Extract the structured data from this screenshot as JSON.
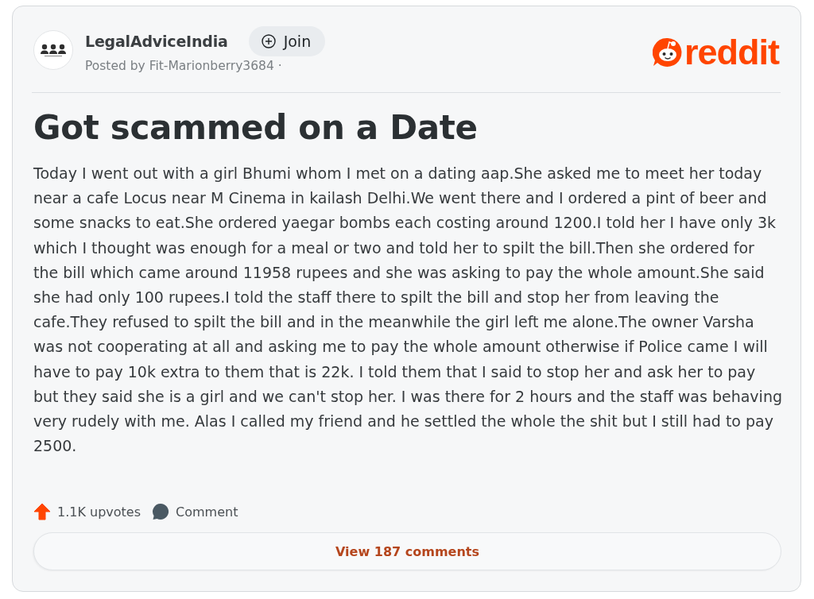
{
  "post": {
    "subreddit": "LegalAdviceIndia",
    "join_button": {
      "label": "Join"
    },
    "posted_by": "Posted by Fit-Marionberry3684 ·",
    "logo": {
      "wordmark": "reddit"
    },
    "title": "Got scammed on a Date",
    "body": "Today I went out with a girl Bhumi whom I met on a dating aap.She asked me to meet her today near a cafe Locus near M Cinema in kailash Delhi.We went there and I ordered a pint of beer and some snacks to eat.She ordered yaegar bombs each costing around 1200.I told her I have only 3k which I thought was enough for a meal or two and told her to spilt the bill.Then she ordered for the bill which came around 11958 rupees and she was asking to pay the whole amount.She said she had only 100 rupees.I told the staff there to spilt the bill and stop her from leaving the cafe.They refused to spilt the bill and in the meanwhile the girl left me alone.The owner Varsha was not cooperating at all and asking me to pay the whole amount otherwise if Police came I will have to pay 10k extra to them that is 22k. I told them that I said to stop her and ask her to pay but they said she is a girl and we can't stop her. I was there for 2 hours and the staff was behaving very rudely with me. Alas I called my friend and he settled the whole the shit but I still had to pay 2500.",
    "upvotes": "1.1K upvotes",
    "comment_button": "Comment",
    "view_comments": "View 187 comments"
  }
}
